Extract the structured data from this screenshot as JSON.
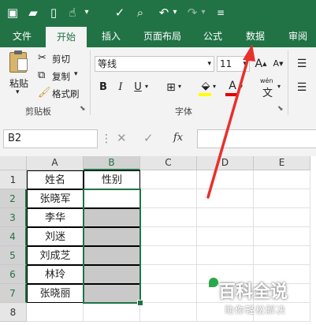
{
  "tabs": [
    "文件",
    "开始",
    "插入",
    "页面布局",
    "公式",
    "数据",
    "审阅"
  ],
  "clipboard": {
    "paste": "粘贴",
    "cut": "剪切",
    "copy": "复制",
    "format_painter": "格式刷",
    "group_label": "剪贴板"
  },
  "font": {
    "name": "等线",
    "size": "11",
    "group_label": "字体",
    "bold": "B",
    "italic": "I",
    "underline": "U",
    "grow": "A",
    "shrink": "A",
    "font_color": "A",
    "wen": "wén",
    "wen2": "文"
  },
  "formula_bar": {
    "name_box": "B2",
    "fx": "fx",
    "value": ""
  },
  "columns": [
    "A",
    "B",
    "C",
    "D",
    "E"
  ],
  "rows": [
    "1",
    "2",
    "3",
    "4",
    "5",
    "6",
    "7",
    "8"
  ],
  "cells": {
    "A1": "姓名",
    "B1": "性别",
    "A2": "张晓军",
    "A3": "李华",
    "A4": "刘迷",
    "A5": "刘成芝",
    "A6": "林玲",
    "A7": "张晓丽"
  },
  "watermark": {
    "title": "百科全说",
    "subtitle": "助你轻松解决"
  },
  "colors": {
    "excel_green": "#217346",
    "arrow_red": "#e8302c",
    "selection_shade": "#c9c9c9"
  }
}
